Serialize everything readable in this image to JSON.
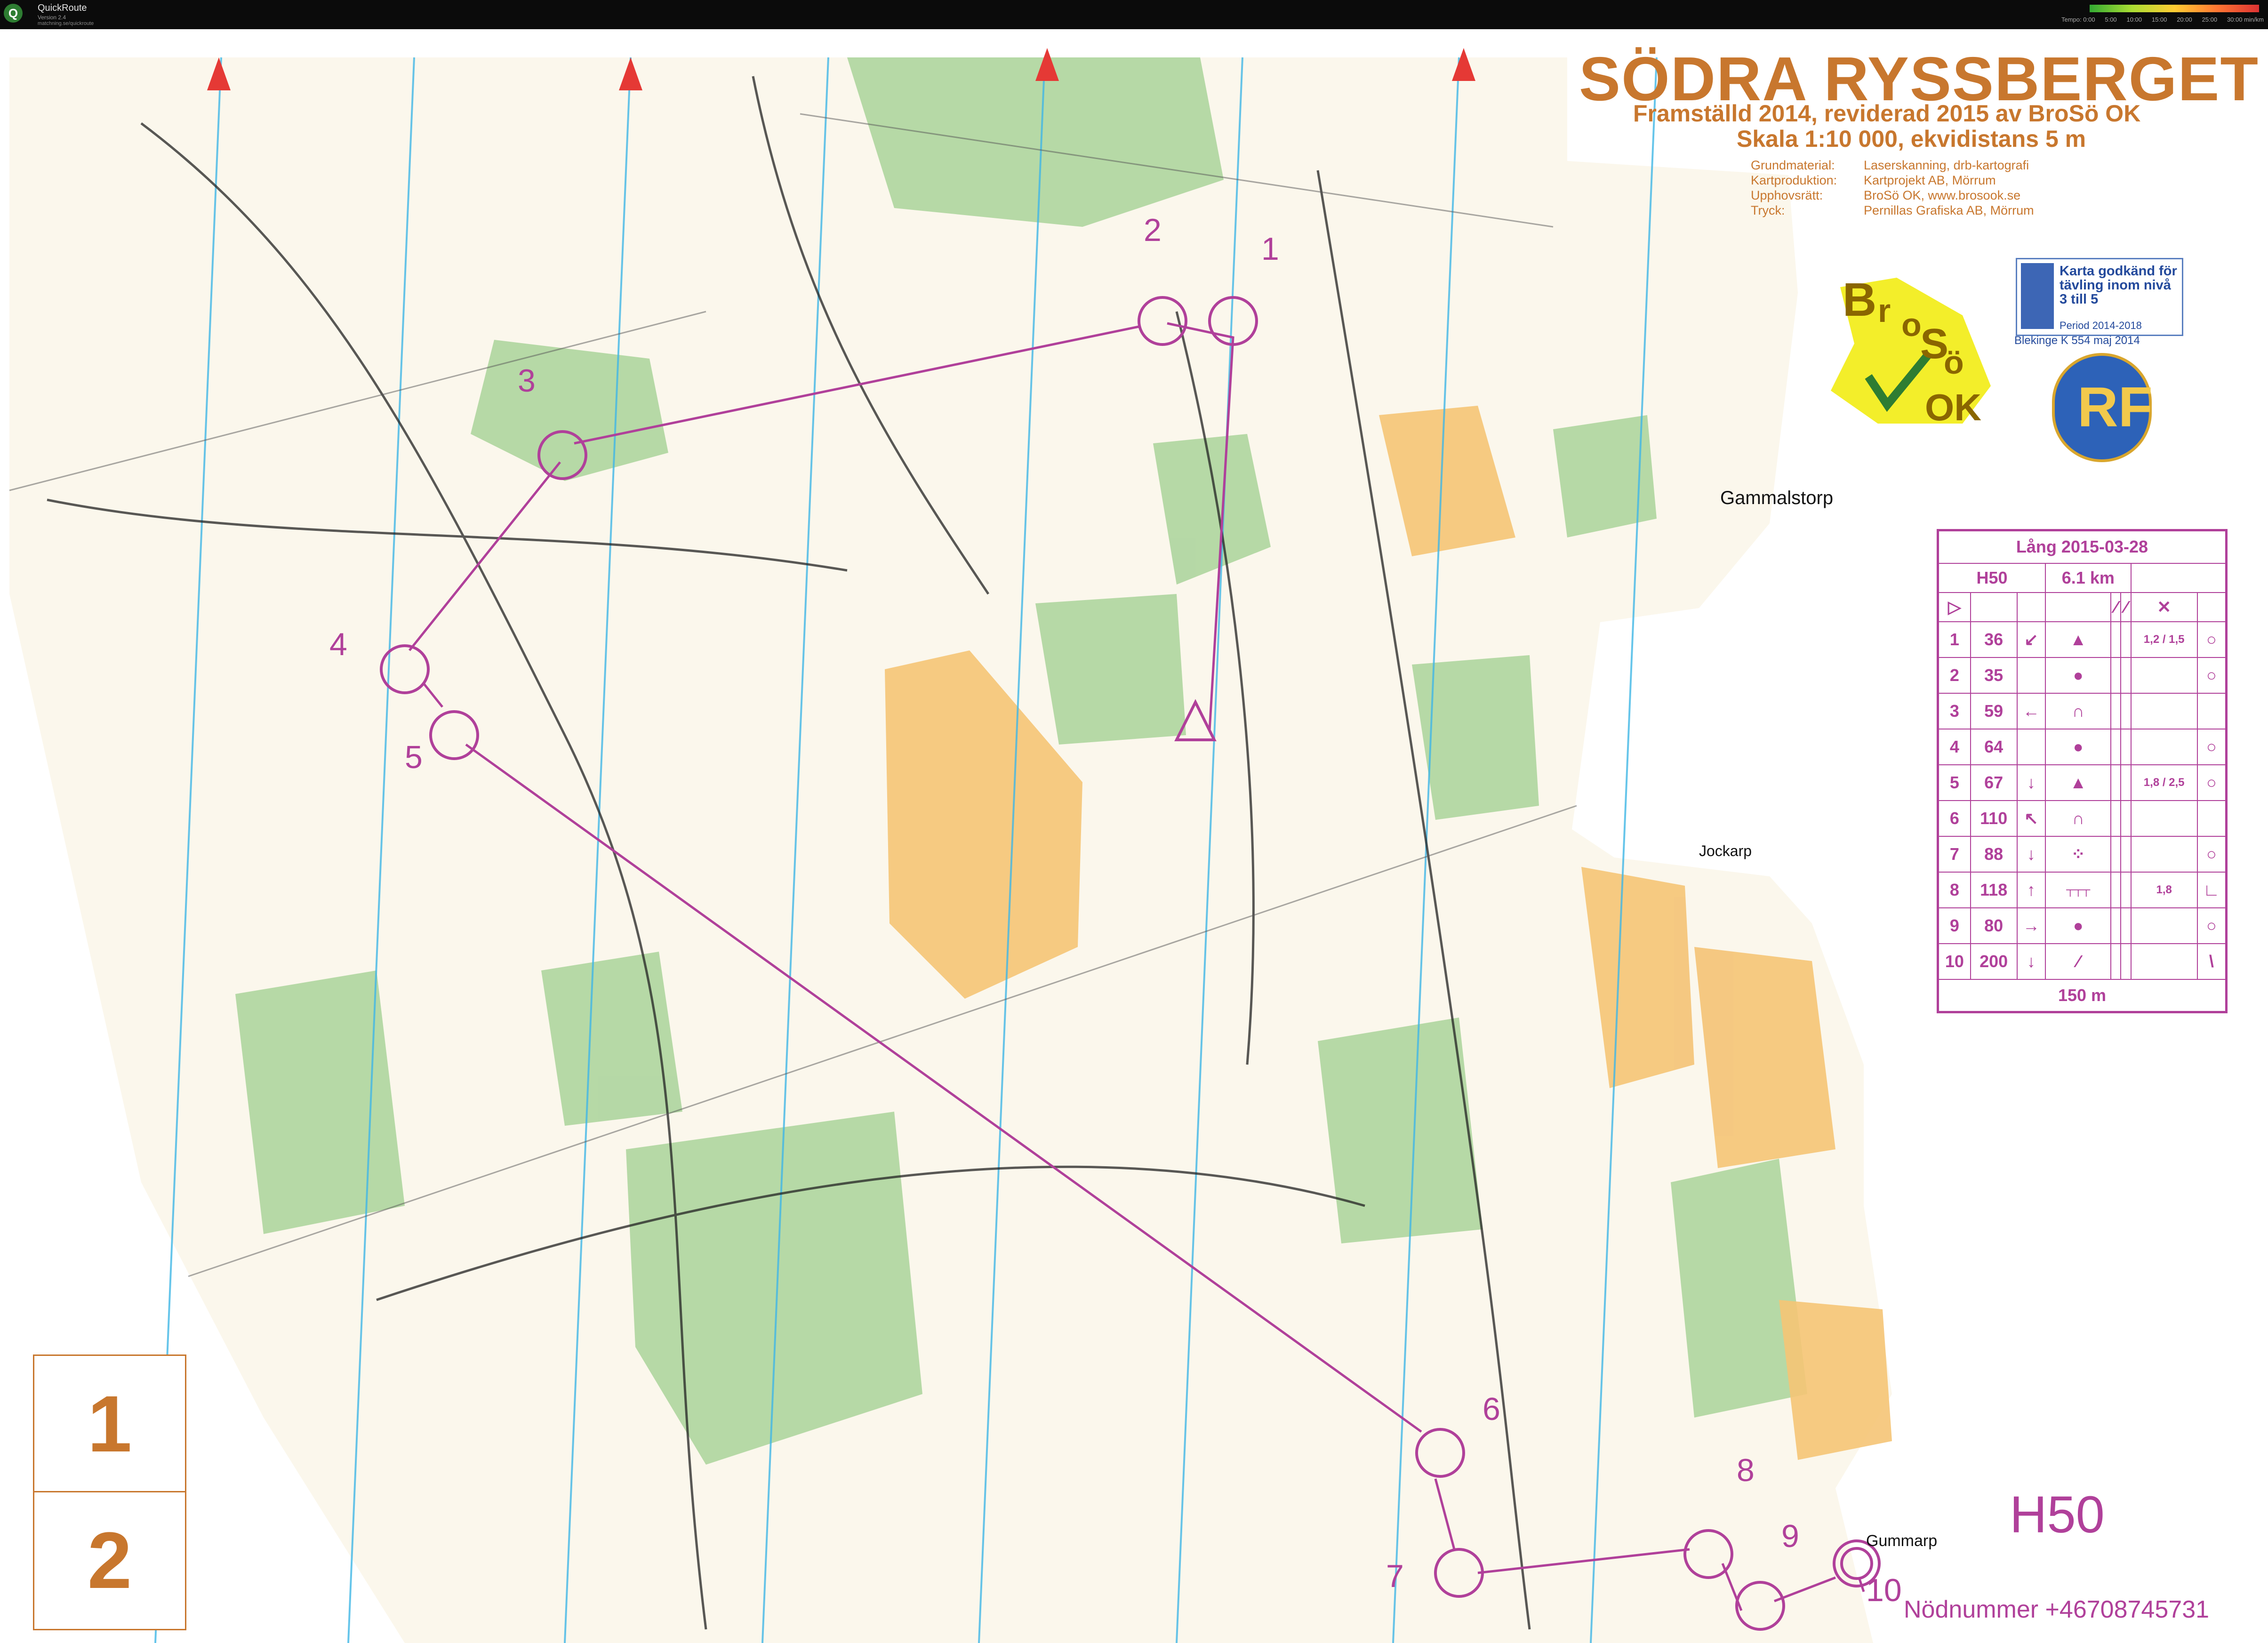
{
  "window": {
    "app_title": "QuickRoute",
    "app_subtitle": "Version 2.4",
    "app_detail": "matchning.se/quickroute",
    "speed_legend": [
      "Tempo: 0:00",
      "5:00",
      "10:00",
      "15:00",
      "20:00",
      "25:00",
      "30:00 min/km"
    ]
  },
  "map": {
    "title": "SÖDRA RYSSBERGET",
    "subtitle_line1": "Framställd 2014, reviderad 2015 av BroSö OK",
    "subtitle_line2": "Skala 1:10 000, ekvidistans 5 m",
    "credits": [
      {
        "key": "Grundmaterial:",
        "value": "Laserskanning, drb-kartografi"
      },
      {
        "key": "Kartproduktion:",
        "value": "Kartprojekt AB, Mörrum"
      },
      {
        "key": "Upphovsrätt:",
        "value": "BroSö OK, www.brosook.se"
      },
      {
        "key": "Tryck:",
        "value": "Pernillas Grafiska AB, Mörrum"
      }
    ],
    "places": {
      "gammalstorp": "Gammalstorp",
      "jockarp": "Jockarp",
      "gummarp": "Gummarp"
    },
    "club_logo_letters": [
      "B",
      "r",
      "o",
      "S",
      "ö",
      "OK"
    ],
    "approval_badge": {
      "text": "Karta godkänd för tävling inom nivå 3 till 5",
      "period": "Period 2014-2018",
      "footer": "Blekinge K 554 maj 2014"
    },
    "federation_logo": "RF",
    "map_boxes": [
      "1",
      "2"
    ],
    "course_name": "H50",
    "emergency_number": "Nödnummer +46708745731",
    "control_numbers": [
      "1",
      "2",
      "3",
      "4",
      "5",
      "6",
      "7",
      "8",
      "9",
      "10"
    ],
    "colors": {
      "title": "#c8772e",
      "course": "#b0409a",
      "vegetation_green": "#a9d39a",
      "open_yellow": "#f5c476",
      "water_blue": "#41b7e6"
    }
  },
  "control_descriptions": {
    "header_title": "Lång 2015-03-28",
    "class": "H50",
    "length": "6.1 km",
    "rows": [
      {
        "n": "1",
        "code": "36",
        "dir": "↙",
        "feat": "▲",
        "dim": "1,2 / 1,5",
        "loc": "○"
      },
      {
        "n": "2",
        "code": "35",
        "dir": "",
        "feat": "●",
        "dim": "",
        "loc": "○"
      },
      {
        "n": "3",
        "code": "59",
        "dir": "←",
        "feat": "∩",
        "dim": "",
        "loc": ""
      },
      {
        "n": "4",
        "code": "64",
        "dir": "",
        "feat": "●",
        "dim": "",
        "loc": "○"
      },
      {
        "n": "5",
        "code": "67",
        "dir": "↓",
        "feat": "▲",
        "dim": "1,8 / 2,5",
        "loc": "○"
      },
      {
        "n": "6",
        "code": "110",
        "dir": "↖",
        "feat": "∩",
        "dim": "",
        "loc": ""
      },
      {
        "n": "7",
        "code": "88",
        "dir": "↓",
        "feat": "⁘",
        "dim": "",
        "loc": "○"
      },
      {
        "n": "8",
        "code": "118",
        "dir": "↑",
        "feat": "┬┬┬",
        "dim": "1,8",
        "loc": "∟"
      },
      {
        "n": "9",
        "code": "80",
        "dir": "→",
        "feat": "●",
        "dim": "",
        "loc": "○"
      },
      {
        "n": "10",
        "code": "200",
        "dir": "↓",
        "feat": "⁄",
        "dim": "",
        "loc": "\\"
      }
    ],
    "finish": "150 m"
  }
}
